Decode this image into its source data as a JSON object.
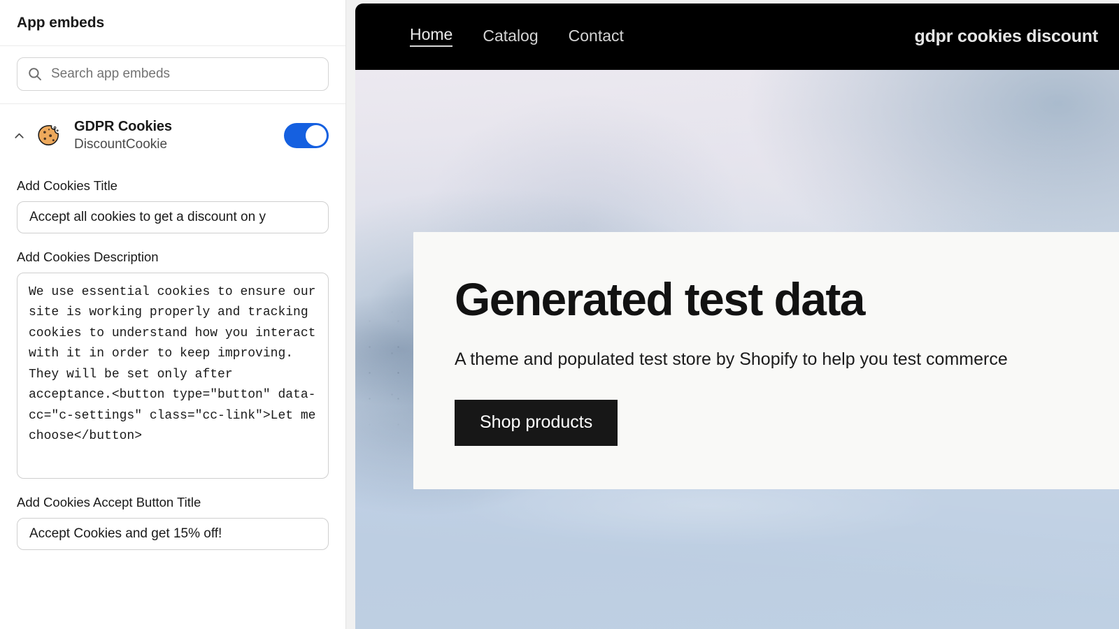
{
  "sidebar": {
    "header_title": "App embeds",
    "search": {
      "placeholder": "Search app embeds",
      "value": ""
    },
    "embed": {
      "title": "GDPR Cookies",
      "subtitle": "DiscountCookie",
      "toggle_state": "on",
      "toggle_color": "#1560e0",
      "collapse_icon": "chevron-up-icon",
      "app_icon": "cookie-icon"
    },
    "fields": [
      {
        "label": "Add Cookies Title",
        "type": "text",
        "value": "Accept all cookies to get a discount on y"
      },
      {
        "label": "Add Cookies Description",
        "type": "textarea",
        "value": "We use essential cookies to ensure our site is working properly and tracking cookies to understand how you interact with it in order to keep improving. They will be set only after acceptance.<button type=\"button\" data-cc=\"c-settings\" class=\"cc-link\">Let me choose</button>"
      },
      {
        "label": "Add Cookies Accept Button Title",
        "type": "text",
        "value": "Accept Cookies and get 15% off!"
      }
    ]
  },
  "preview": {
    "nav": {
      "links": [
        {
          "label": "Home",
          "active": true
        },
        {
          "label": "Catalog",
          "active": false
        },
        {
          "label": "Contact",
          "active": false
        }
      ],
      "store_name": "gdpr cookies discount",
      "background_color": "#000000"
    },
    "hero": {
      "title": "Generated test data",
      "subtitle": "A theme and populated test store by Shopify to help you test commerce",
      "button_label": "Shop products",
      "card_background": "#f9f9f7",
      "button_background": "#171717"
    }
  }
}
